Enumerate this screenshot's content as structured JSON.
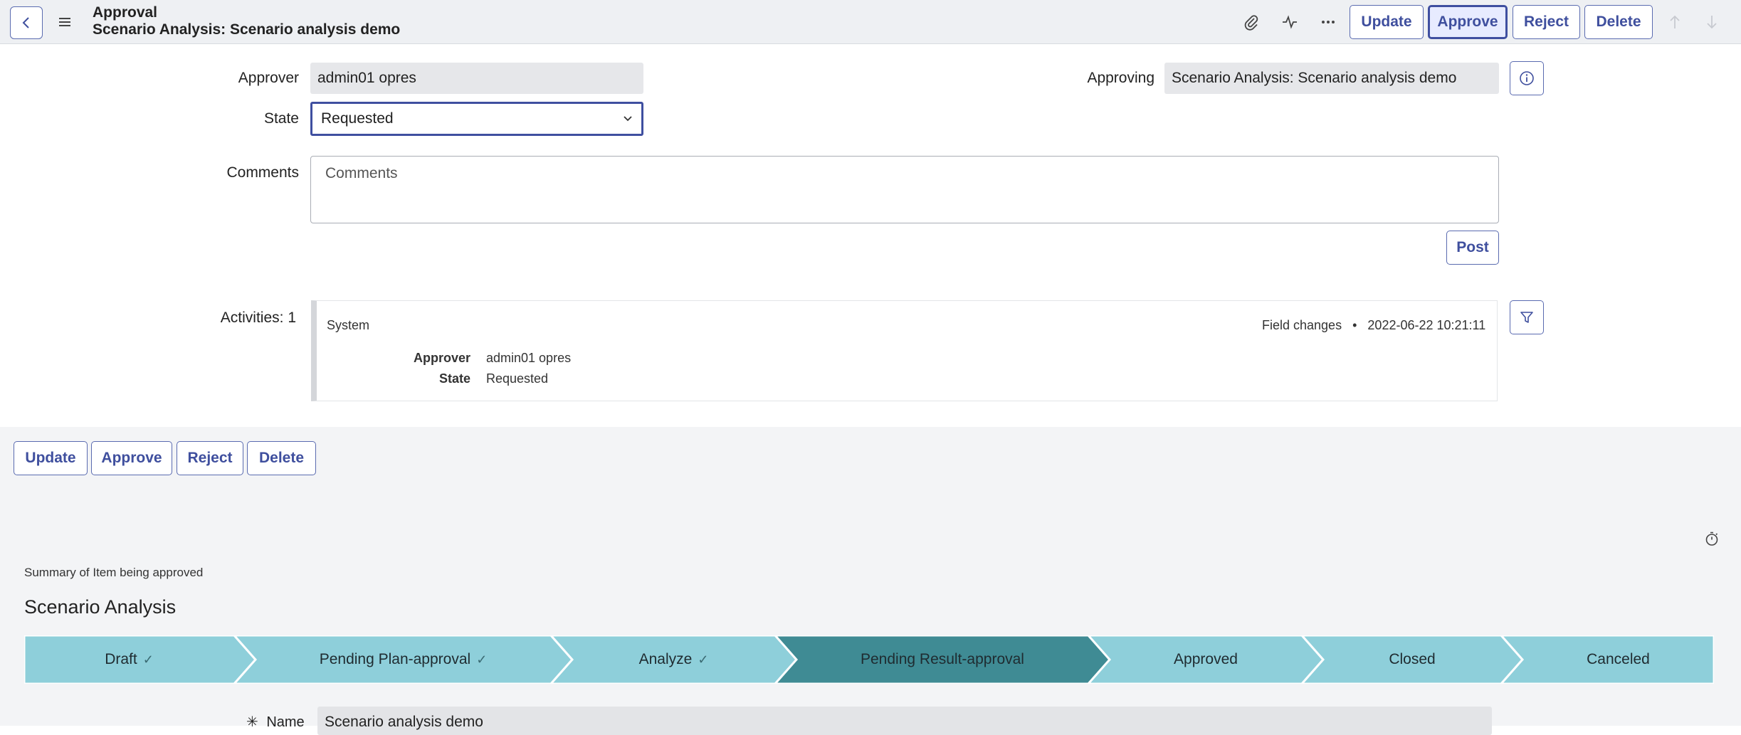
{
  "header": {
    "title": "Approval",
    "subtitle": "Scenario Analysis: Scenario analysis demo",
    "buttons": {
      "update": "Update",
      "approve": "Approve",
      "reject": "Reject",
      "delete": "Delete"
    }
  },
  "form": {
    "approver_label": "Approver",
    "approver_value": "admin01 opres",
    "approving_label": "Approving",
    "approving_value": "Scenario Analysis: Scenario analysis demo",
    "state_label": "State",
    "state_value": "Requested",
    "comments_label": "Comments",
    "comments_placeholder": "Comments",
    "post_button": "Post"
  },
  "activities": {
    "label": "Activities: 1",
    "source": "System",
    "change_type": "Field changes",
    "bullet": "•",
    "timestamp": "2022-06-22 10:21:11",
    "rows": [
      {
        "field": "Approver",
        "value": "admin01 opres"
      },
      {
        "field": "State",
        "value": "Requested"
      }
    ]
  },
  "bottom_buttons": {
    "update": "Update",
    "approve": "Approve",
    "reject": "Reject",
    "delete": "Delete"
  },
  "summary": {
    "caption": "Summary of Item being approved",
    "heading": "Scenario Analysis",
    "stages": [
      {
        "label": "Draft",
        "done": true
      },
      {
        "label": "Pending Plan-approval",
        "done": true
      },
      {
        "label": "Analyze",
        "done": true
      },
      {
        "label": "Pending Result-approval",
        "current": true
      },
      {
        "label": "Approved"
      },
      {
        "label": "Closed"
      },
      {
        "label": "Canceled"
      }
    ],
    "check": "✓",
    "name_label": "Name",
    "required_mark": "✳",
    "name_value": "Scenario analysis demo"
  },
  "colors": {
    "stage": "#8ecfda",
    "stage_current": "#3f8b94",
    "accent": "#3f4f9e"
  }
}
